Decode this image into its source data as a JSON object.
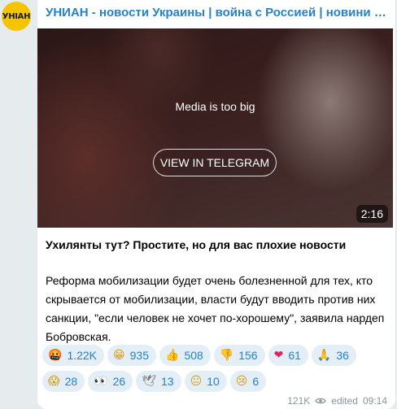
{
  "channel": {
    "avatar_text": "УНІАН",
    "title": "УНИАН - новости Украины | война с Россией | новини України"
  },
  "media": {
    "notice": "Media is too big",
    "button_label": "VIEW IN TELEGRAM",
    "duration": "2:16"
  },
  "post": {
    "title": "Ухилянты тут? Простите, но для вас плохие новости",
    "body": "Реформа мобилизации будет очень болезненной для тех, кто скрывается от мобилизации, власти будут вводить против них санкции, \"если человек не хочет по-хорошему\", заявила нардеп Бобровская."
  },
  "reactions": [
    {
      "emoji": "🤬",
      "count": "1.22K"
    },
    {
      "emoji": "😁",
      "count": "935"
    },
    {
      "emoji": "👍",
      "count": "508"
    },
    {
      "emoji": "👎",
      "count": "156"
    },
    {
      "emoji": "❤",
      "count": "61"
    },
    {
      "emoji": "🙏",
      "count": "36"
    },
    {
      "emoji": "😱",
      "count": "28"
    },
    {
      "emoji": "👀",
      "count": "26"
    },
    {
      "emoji": "🕊",
      "count": "13"
    },
    {
      "emoji": "😐",
      "count": "10"
    },
    {
      "emoji": "😢",
      "count": "6"
    }
  ],
  "meta": {
    "views": "121K",
    "edited_label": "edited",
    "time": "09:14"
  }
}
